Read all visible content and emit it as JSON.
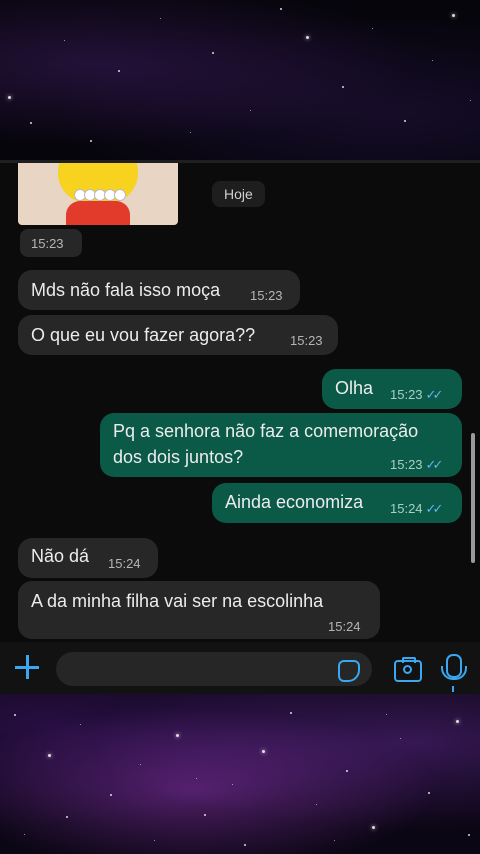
{
  "chat": {
    "day_label": "Hoje",
    "image_time": "15:23",
    "messages": [
      {
        "text": "Mds não fala isso moça",
        "time": "15:23"
      },
      {
        "text": "O que eu vou fazer agora??",
        "time": "15:23"
      },
      {
        "text": "Olha",
        "time": "15:23"
      },
      {
        "line1": "Pq a senhora não faz a comemoração",
        "line2": "dos dois juntos?",
        "time": "15:23"
      },
      {
        "text": "Ainda economiza",
        "time": "15:24"
      },
      {
        "text": "Não dá",
        "time": "15:24"
      },
      {
        "text": "A da minha filha vai ser na escolinha",
        "time": "15:24"
      }
    ],
    "read_receipt": "✓✓"
  },
  "composer": {
    "input_value": "",
    "icons": [
      "plus-icon",
      "sticker-icon",
      "camera-icon",
      "microphone-icon"
    ],
    "accent_color": "#3aa7f0"
  },
  "colors": {
    "incoming_bubble": "#272727",
    "outgoing_bubble": "#0b5a47",
    "chat_background": "#0b0b0b"
  }
}
